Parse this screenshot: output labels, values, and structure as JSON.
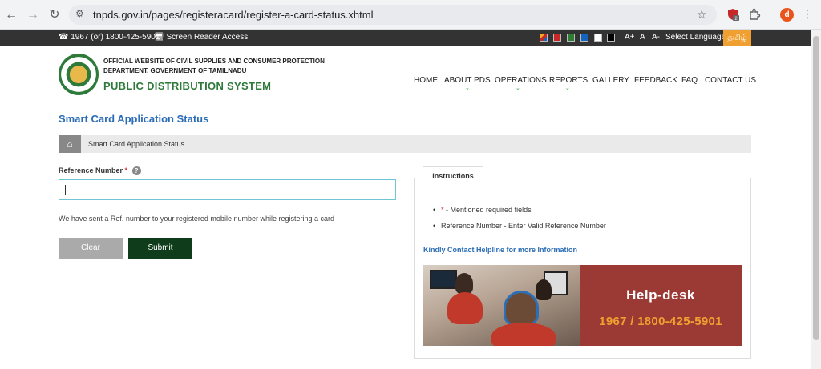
{
  "browser": {
    "url": "tnpds.gov.in/pages/registeracard/register-a-card-status.xhtml",
    "avatar_letter": "d",
    "ext_badge": "2"
  },
  "topbar": {
    "phone": "1967 (or) 1800-425-5901",
    "screen_reader": "Screen Reader Access",
    "font_increase": "A+",
    "font_normal": "A",
    "font_decrease": "A-",
    "select_language": "Select Language",
    "language": "தமிழ்",
    "theme_colors": [
      "#f5a623",
      "#c62828",
      "#2e7d32",
      "#1565c0",
      "#ffffff",
      "#000000"
    ]
  },
  "header": {
    "org_line1": "OFFICIAL WEBSITE OF CIVIL SUPPLIES AND CONSUMER PROTECTION",
    "org_line2": "DEPARTMENT, GOVERNMENT OF TAMILNADU",
    "site_title": "PUBLIC DISTRIBUTION SYSTEM"
  },
  "nav": {
    "items": [
      {
        "label": "HOME"
      },
      {
        "label": "ABOUT PDS"
      },
      {
        "label": "OPERATIONS"
      },
      {
        "label": "REPORTS"
      },
      {
        "label": "GALLERY"
      },
      {
        "label": "FEEDBACK"
      },
      {
        "label": "FAQ"
      },
      {
        "label": "CONTACT US"
      }
    ]
  },
  "page": {
    "title": "Smart Card Application Status",
    "breadcrumb": "Smart Card Application Status"
  },
  "form": {
    "ref_label": "Reference Number",
    "required_mark": "*",
    "help_mark": "?",
    "ref_value": "",
    "ref_note": "We have sent a Ref. number to your registered mobile number while registering a card",
    "clear_label": "Clear",
    "submit_label": "Submit"
  },
  "instructions": {
    "tab_label": "Instructions",
    "items": [
      {
        "mark": "*",
        "text": " - Mentioned required fields"
      },
      {
        "mark": "",
        "text": "Reference Number - Enter Valid Reference Number"
      }
    ],
    "helpline_text": "Kindly Contact Helpline for more Information",
    "banner_title": "Help-desk",
    "banner_phone": "1967 / 1800-425-5901"
  }
}
